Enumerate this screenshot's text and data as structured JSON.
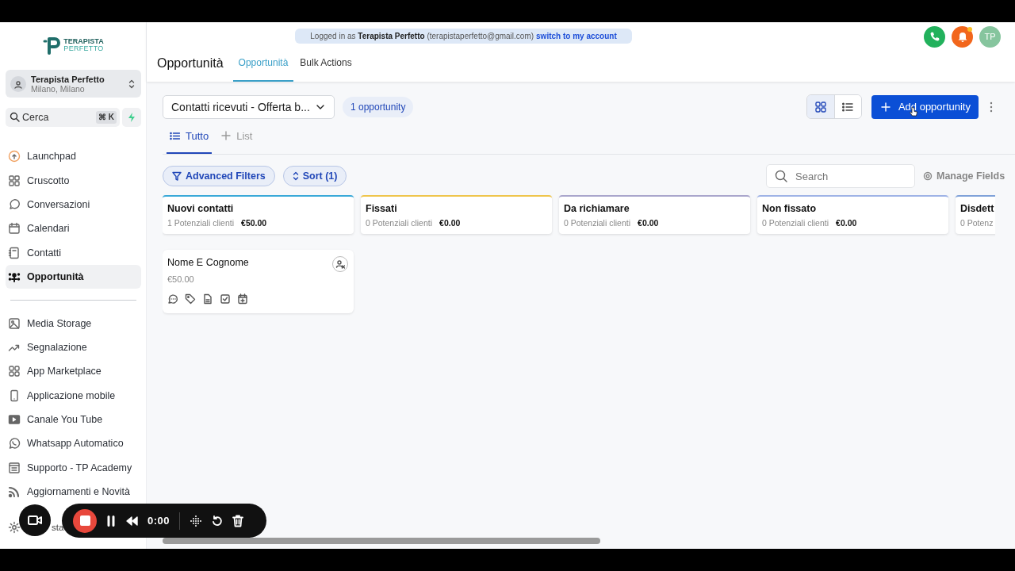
{
  "logo": {
    "line1": "TERAPISTA",
    "line2": "PERFETTO"
  },
  "account": {
    "name": "Terapista Perfetto",
    "location": "Milano, Milano"
  },
  "search": {
    "placeholder": "Cerca",
    "shortcut": "⌘ K"
  },
  "nav_main": [
    {
      "label": "Launchpad",
      "selected": false
    },
    {
      "label": "Cruscotto",
      "selected": false
    },
    {
      "label": "Conversazioni",
      "selected": false
    },
    {
      "label": "Calendari",
      "selected": false
    },
    {
      "label": "Contatti",
      "selected": false
    },
    {
      "label": "Opportunità",
      "selected": true
    }
  ],
  "nav_extra": [
    {
      "label": "Media Storage"
    },
    {
      "label": "Segnalazione"
    },
    {
      "label": "App Marketplace"
    },
    {
      "label": "Applicazione mobile"
    },
    {
      "label": "Canale You Tube"
    },
    {
      "label": "Whatsapp Automatico"
    },
    {
      "label": "Supporto - TP Academy"
    },
    {
      "label": "Aggiornamenti e Novità"
    }
  ],
  "nav_bottom": {
    "label": "sta"
  },
  "banner": {
    "prefix": "Logged in as",
    "name": "Terapista Perfetto",
    "email": "(terapistaperfetto@gmail.com)",
    "link": "switch to my account"
  },
  "header": {
    "title": "Opportunità",
    "avatar": "TP",
    "notification_dot": true
  },
  "tabs": [
    {
      "label": "Opportunità",
      "selected": true
    },
    {
      "label": "Bulk Actions",
      "selected": false
    }
  ],
  "pipeline": {
    "value": "Contatti ricevuti - Offerta b...",
    "count": "1 opportunity"
  },
  "view_toggle": [
    {
      "kind": "grid",
      "selected": true
    },
    {
      "kind": "list",
      "selected": false
    }
  ],
  "add_button": "Add opportunity",
  "subtabs": [
    {
      "label": "Tutto",
      "kind": "view",
      "selected": true
    },
    {
      "label": "List",
      "kind": "add",
      "selected": false
    }
  ],
  "filters": [
    {
      "label": "Advanced Filters",
      "kind": "filter"
    },
    {
      "label": "Sort (1)",
      "kind": "sort"
    }
  ],
  "board_search": {
    "placeholder": "Search"
  },
  "manage_fields": "Manage Fields",
  "columns": [
    {
      "title": "Nuovi contatti",
      "count": "1 Potenziali clienti",
      "amount": "€50.00",
      "color": "#3aa9d8",
      "cards": [
        {
          "name": "Nome E Cognome",
          "amount": "€50.00"
        }
      ]
    },
    {
      "title": "Fissati",
      "count": "0 Potenziali clienti",
      "amount": "€0.00",
      "color": "#efc54c"
    },
    {
      "title": "Da richiamare",
      "count": "0 Potenziali clienti",
      "amount": "€0.00",
      "color": "#aaa6cc"
    },
    {
      "title": "Non fissato",
      "count": "0 Potenziali clienti",
      "amount": "€0.00",
      "color": "#9fb3e6"
    },
    {
      "title": "Disdett",
      "count": "0 Potenz",
      "color": "#80a2d9"
    }
  ],
  "recorder": {
    "time": "0:00"
  }
}
